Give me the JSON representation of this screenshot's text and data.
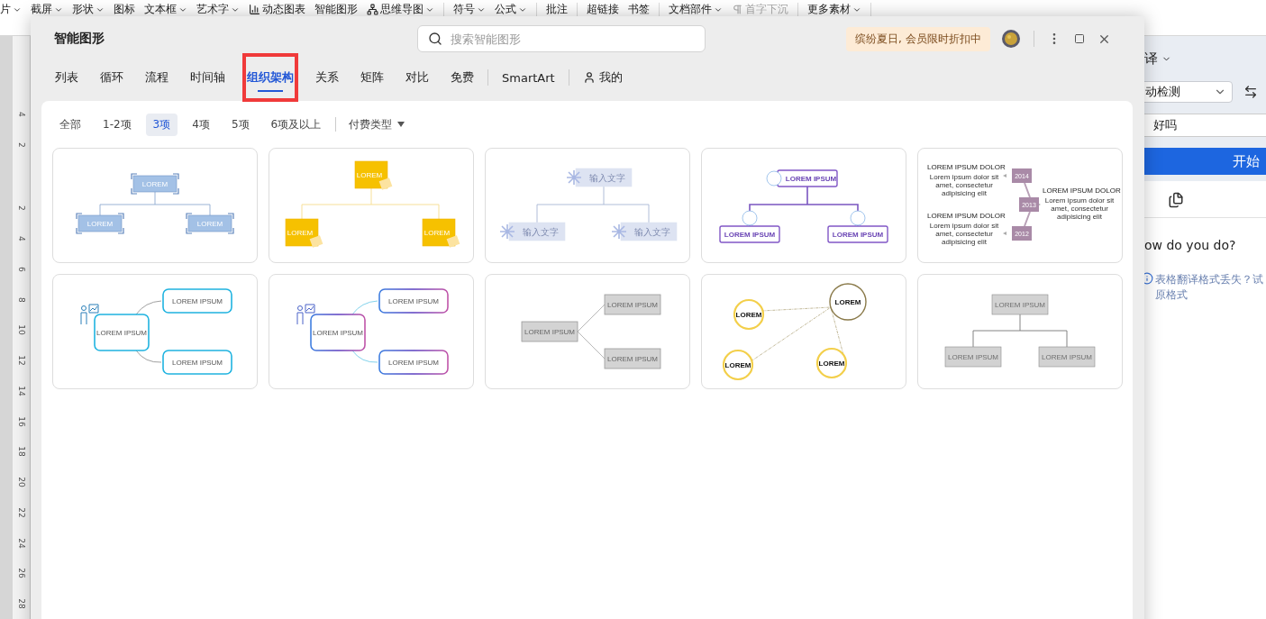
{
  "ribbon": {
    "groups": [
      [
        {
          "label": "片",
          "kind": "plain",
          "caret": true,
          "disabled": false
        },
        {
          "label": "截屏",
          "kind": "plain",
          "caret": true,
          "disabled": false
        },
        {
          "label": "形状",
          "kind": "plain",
          "caret": true,
          "disabled": false
        },
        {
          "label": "图标",
          "kind": "plain",
          "caret": false,
          "disabled": false
        },
        {
          "label": "文本框",
          "kind": "plain",
          "caret": true,
          "disabled": false
        },
        {
          "label": "艺术字",
          "kind": "plain",
          "caret": true,
          "disabled": false
        },
        {
          "label": "动态图表",
          "kind": "chart",
          "caret": false,
          "disabled": false
        },
        {
          "label": "智能图形",
          "kind": "plain",
          "caret": false,
          "disabled": false
        },
        {
          "label": "思维导图",
          "kind": "mindmap",
          "caret": true,
          "disabled": false
        }
      ],
      [
        {
          "label": "符号",
          "kind": "plain",
          "caret": true,
          "disabled": false
        },
        {
          "label": "公式",
          "kind": "plain",
          "caret": true,
          "disabled": false
        }
      ],
      [
        {
          "label": "批注",
          "kind": "plain",
          "caret": false,
          "disabled": false
        }
      ],
      [
        {
          "label": "超链接",
          "kind": "plain",
          "caret": false,
          "disabled": false
        },
        {
          "label": "书签",
          "kind": "plain",
          "caret": false,
          "disabled": false
        }
      ],
      [
        {
          "label": "文档部件",
          "kind": "plain",
          "caret": true,
          "disabled": false
        },
        {
          "label": "首字下沉",
          "kind": "dropcap",
          "caret": false,
          "disabled": true
        }
      ],
      [
        {
          "label": "更多素材",
          "kind": "plain",
          "caret": true,
          "disabled": false
        }
      ]
    ]
  },
  "ruler": {
    "above": [
      "4",
      "2"
    ],
    "below": [
      "2",
      "4",
      "6",
      "8",
      "10",
      "12",
      "14",
      "16",
      "18",
      "20",
      "22",
      "24",
      "26",
      "28"
    ]
  },
  "dialog": {
    "title": "智能图形",
    "search": {
      "placeholder": "搜索智能图形"
    },
    "promo": "缤纷夏日, 会员限时折扣中",
    "tabs": [
      {
        "label": "列表",
        "kind": "category",
        "selected": false,
        "highlighted": false
      },
      {
        "label": "循环",
        "kind": "category",
        "selected": false,
        "highlighted": false
      },
      {
        "label": "流程",
        "kind": "category",
        "selected": false,
        "highlighted": false
      },
      {
        "label": "时间轴",
        "kind": "category",
        "selected": false,
        "highlighted": false
      },
      {
        "label": "组织架构",
        "kind": "category",
        "selected": true,
        "highlighted": true
      },
      {
        "label": "关系",
        "kind": "category",
        "selected": false,
        "highlighted": false
      },
      {
        "label": "矩阵",
        "kind": "category",
        "selected": false,
        "highlighted": false
      },
      {
        "label": "对比",
        "kind": "category",
        "selected": false,
        "highlighted": false
      },
      {
        "label": "免费",
        "kind": "category",
        "selected": false,
        "highlighted": false
      },
      {
        "label": "SmartArt",
        "kind": "smartart",
        "selected": false,
        "highlighted": false
      },
      {
        "label": "我的",
        "kind": "mine",
        "selected": false,
        "highlighted": false
      }
    ],
    "filters": [
      {
        "label": "全部",
        "selected": false
      },
      {
        "label": "1-2项",
        "selected": false
      },
      {
        "label": "3项",
        "selected": true
      },
      {
        "label": "4项",
        "selected": false
      },
      {
        "label": "5项",
        "selected": false
      },
      {
        "label": "6项及以上",
        "selected": false
      }
    ],
    "pay_filter": "付费类型",
    "cards": [
      {
        "kind": "bracket-tree",
        "labels": [
          "LOREM",
          "LOREM",
          "LOREM"
        ]
      },
      {
        "kind": "stamp-tree",
        "labels": [
          "LOREM",
          "LOREM",
          "LOREM"
        ]
      },
      {
        "kind": "snowflake-tree",
        "labels": [
          "输入文字",
          "输入文字",
          "输入文字"
        ]
      },
      {
        "kind": "icon-tree",
        "labels": [
          "LOREM IPSUM",
          "LOREM IPSUM",
          "LOREM IPSUM"
        ]
      },
      {
        "kind": "timeline",
        "years": [
          "2014",
          "2013",
          "2012"
        ],
        "blocks": [
          {
            "title": "LOREM IPSUM DOLOR",
            "body": "Lorem ipsum dolor sit amet, consectetur adipisicing elit"
          },
          {
            "title": "LOREM IPSUM DOLOR",
            "body": "Lorem ipsum dolor sit amet, consectetur adipisicing elit"
          },
          {
            "title": "LOREM IPSUM DOLOR",
            "body": "Lorem ipsum dolor sit amet, consectetur adipisicing elit"
          }
        ]
      },
      {
        "kind": "presenter",
        "labels": [
          "LOREM IPSUM",
          "LOREM IPSUM",
          "LOREM IPSUM"
        ]
      },
      {
        "kind": "gradient-presenter",
        "labels": [
          "LOREM IPSUM",
          "LOREM IPSUM",
          "LOREM IPSUM"
        ]
      },
      {
        "kind": "branch",
        "labels": [
          "LOREM IPSUM",
          "LOREM IPSUM",
          "LOREM IPSUM"
        ]
      },
      {
        "kind": "orbit",
        "labels": [
          "LOREM",
          "LOREM",
          "LOREM",
          "LOREM"
        ]
      },
      {
        "kind": "ribbon-tree",
        "labels": [
          "LOREM IPSUM",
          "LOREM IPSUM",
          "LOREM IPSUM"
        ]
      }
    ]
  },
  "translate_panel": {
    "title": "译",
    "source_language": "动检测",
    "input": "好吗",
    "button": "开始",
    "result": "ow do you do?",
    "notice": [
      "表格翻译格式丢失？试",
      "原格式"
    ]
  }
}
